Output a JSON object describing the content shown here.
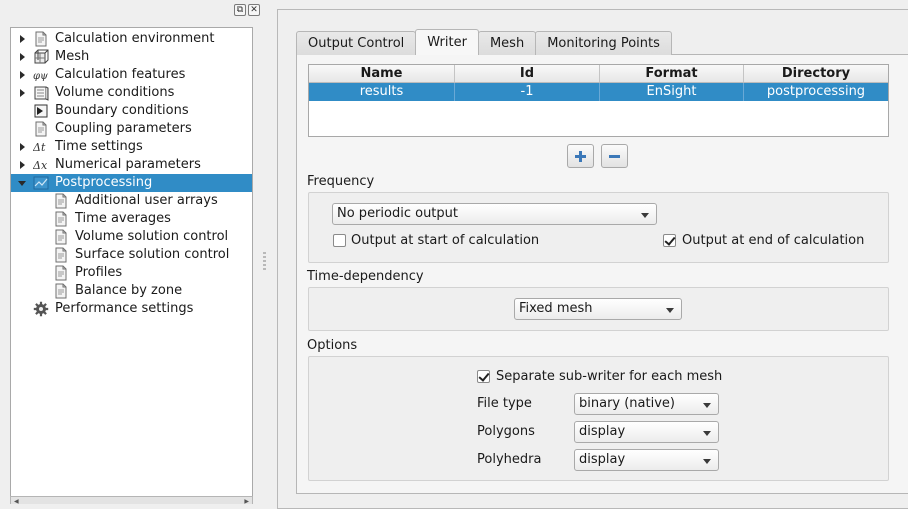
{
  "tree": {
    "items": [
      {
        "label": "Calculation environment",
        "icon": "document-icon",
        "level": 0,
        "arrow": "right",
        "selected": false
      },
      {
        "label": "Mesh",
        "icon": "mesh-cube-icon",
        "level": 0,
        "arrow": "right",
        "selected": false
      },
      {
        "label": "Calculation features",
        "icon": "phi-psi-icon",
        "level": 0,
        "arrow": "right",
        "selected": false
      },
      {
        "label": "Volume conditions",
        "icon": "volume-icon",
        "level": 0,
        "arrow": "right",
        "selected": false
      },
      {
        "label": "Boundary conditions",
        "icon": "boundary-icon",
        "level": 0,
        "arrow": "none",
        "selected": false
      },
      {
        "label": "Coupling parameters",
        "icon": "document-icon",
        "level": 0,
        "arrow": "none",
        "selected": false
      },
      {
        "label": "Time settings",
        "icon": "delta-t-icon",
        "level": 0,
        "arrow": "right",
        "selected": false
      },
      {
        "label": "Numerical parameters",
        "icon": "delta-x-icon",
        "level": 0,
        "arrow": "right",
        "selected": false
      },
      {
        "label": "Postprocessing",
        "icon": "chart-icon",
        "level": 0,
        "arrow": "down",
        "selected": true
      },
      {
        "label": "Additional user arrays",
        "icon": "document-icon",
        "level": 1,
        "arrow": "none",
        "selected": false
      },
      {
        "label": "Time averages",
        "icon": "document-icon",
        "level": 1,
        "arrow": "none",
        "selected": false
      },
      {
        "label": "Volume solution control",
        "icon": "document-icon",
        "level": 1,
        "arrow": "none",
        "selected": false
      },
      {
        "label": "Surface solution control",
        "icon": "document-icon",
        "level": 1,
        "arrow": "none",
        "selected": false
      },
      {
        "label": "Profiles",
        "icon": "document-icon",
        "level": 1,
        "arrow": "none",
        "selected": false
      },
      {
        "label": "Balance by zone",
        "icon": "document-icon",
        "level": 1,
        "arrow": "none",
        "selected": false
      },
      {
        "label": "Performance settings",
        "icon": "gear-icon",
        "level": 0,
        "arrow": "none",
        "selected": false
      }
    ]
  },
  "tabs": [
    {
      "label": "Output Control",
      "active": false
    },
    {
      "label": "Writer",
      "active": true
    },
    {
      "label": "Mesh",
      "active": false
    },
    {
      "label": "Monitoring Points",
      "active": false
    }
  ],
  "writer_table": {
    "headers": [
      "Name",
      "Id",
      "Format",
      "Directory"
    ],
    "rows": [
      [
        "results",
        "-1",
        "EnSight",
        "postprocessing"
      ]
    ]
  },
  "buttons": {
    "add_icon": "plus-icon",
    "remove_icon": "minus-icon"
  },
  "frequency": {
    "label": "Frequency",
    "mode": "No periodic output",
    "start_label": "Output at start of calculation",
    "start_checked": false,
    "end_label": "Output at end of calculation",
    "end_checked": true
  },
  "time_dependency": {
    "label": "Time-dependency",
    "value": "Fixed mesh"
  },
  "options": {
    "label": "Options",
    "separate_label": "Separate sub-writer for each mesh",
    "separate_checked": true,
    "file_type_label": "File type",
    "file_type_value": "binary (native)",
    "polygons_label": "Polygons",
    "polygons_value": "display",
    "polyhedra_label": "Polyhedra",
    "polyhedra_value": "display"
  },
  "colors": {
    "selection": "#308cc6",
    "panel": "#efefef"
  }
}
